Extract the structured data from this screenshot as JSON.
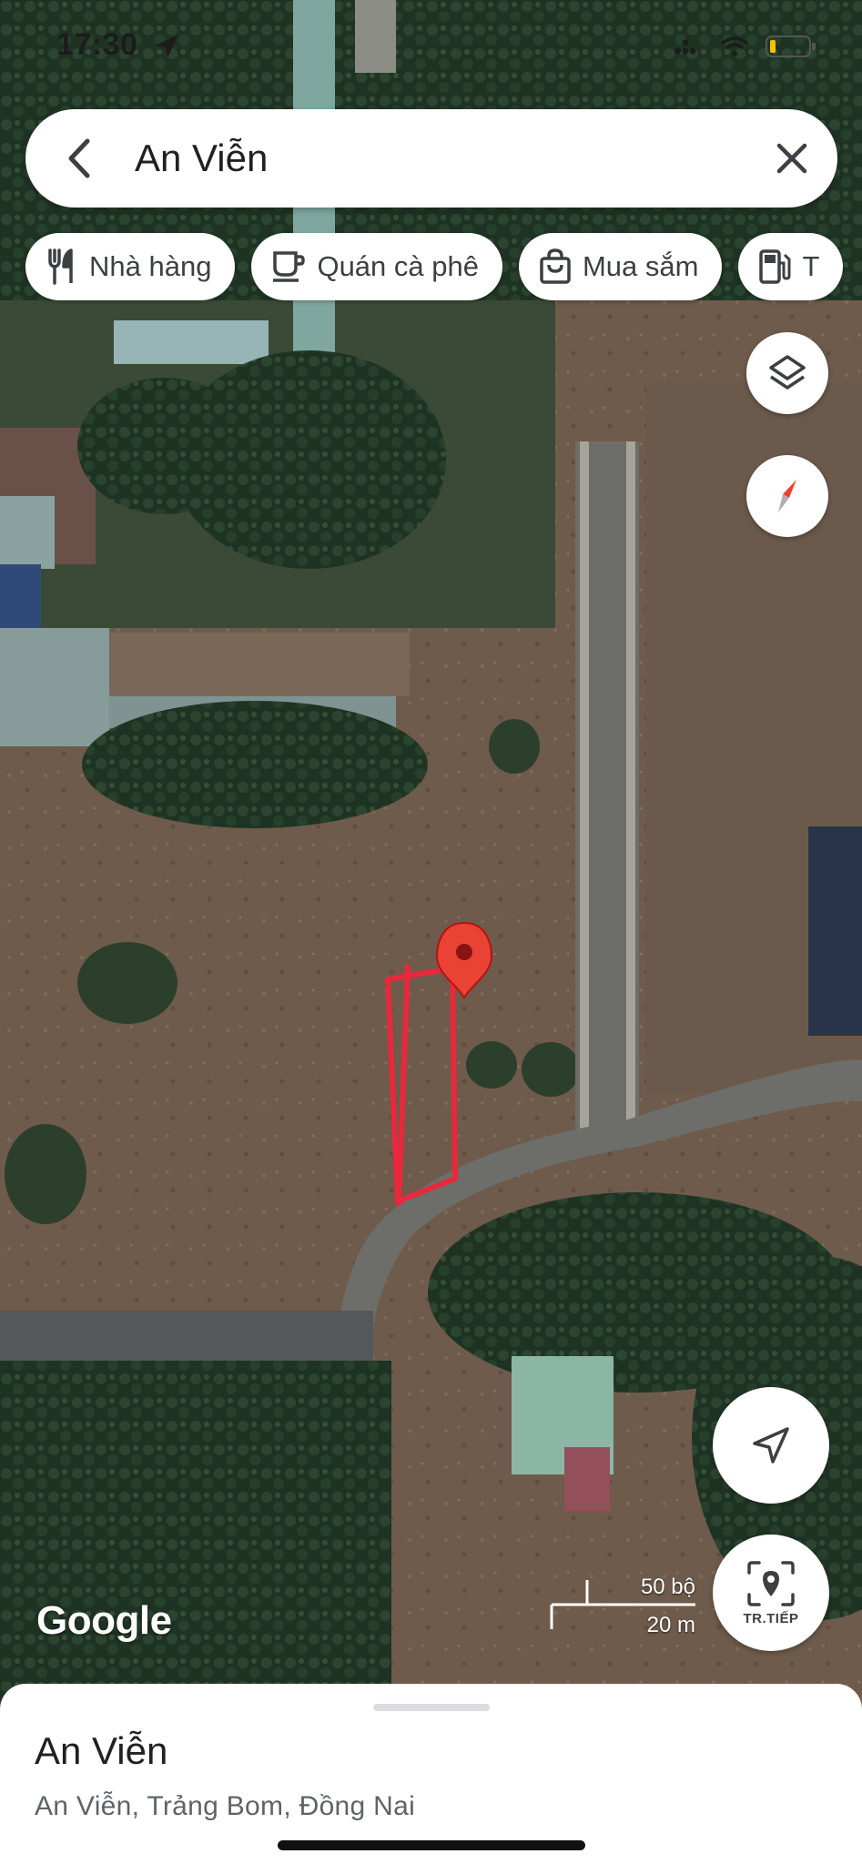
{
  "status_bar": {
    "time": "17:30"
  },
  "search": {
    "query": "An Viễn"
  },
  "chips": [
    {
      "label": "Nhà hàng",
      "icon": "restaurant-icon"
    },
    {
      "label": "Quán cà phê",
      "icon": "coffee-icon"
    },
    {
      "label": "Mua sắm",
      "icon": "shopping-bag-icon"
    },
    {
      "label": "T",
      "icon": "gas-station-icon"
    }
  ],
  "map": {
    "logo": "Google",
    "scale_imperial": "50 bộ",
    "scale_metric": "20 m",
    "nearby_label": "TR.TIẾP",
    "marker_color": "#ea4335",
    "drawn_outline_color": "#e8283c"
  },
  "place": {
    "title": "An Viễn",
    "address": "An Viễn, Trảng Bom, Đồng Nai"
  }
}
